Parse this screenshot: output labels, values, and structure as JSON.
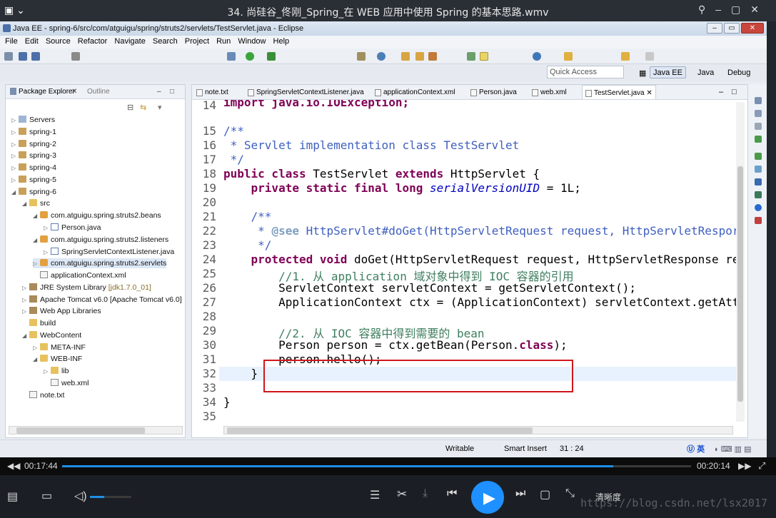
{
  "player": {
    "title": "34. 尚硅谷_佟刚_Spring_在 WEB 应用中使用 Spring 的基本思路.wmv",
    "time_elapsed": "00:17:44",
    "time_total": "00:20:14",
    "progress": 0.876,
    "volume": 0.35,
    "quality_label": "清晰度",
    "watermark": "https://blog.csdn.net/lsx2017"
  },
  "eclipse": {
    "window_title": "Java EE - spring-6/src/com/atguigu/spring/struts2/servlets/TestServlet.java - Eclipse",
    "menu": [
      "File",
      "Edit",
      "Source",
      "Refactor",
      "Navigate",
      "Search",
      "Project",
      "Run",
      "Window",
      "Help"
    ],
    "quick_access_placeholder": "Quick Access",
    "perspectives": [
      "Java EE",
      "Java",
      "Debug"
    ],
    "side_tabs": {
      "package_explorer": "Package Explorer",
      "outline": "Outline"
    },
    "tree": [
      {
        "label": "Servers",
        "icon": "server-folder-icon"
      },
      {
        "label": "spring-1",
        "icon": "project-icon"
      },
      {
        "label": "spring-2",
        "icon": "project-icon"
      },
      {
        "label": "spring-3",
        "icon": "project-icon"
      },
      {
        "label": "spring-4",
        "icon": "project-icon"
      },
      {
        "label": "spring-5",
        "icon": "project-icon"
      },
      {
        "label": "spring-6",
        "icon": "project-icon"
      },
      {
        "label": "src",
        "icon": "source-folder-icon"
      },
      {
        "label": "com.atguigu.spring.struts2.beans",
        "icon": "package-icon"
      },
      {
        "label": "Person.java",
        "icon": "java-file-icon"
      },
      {
        "label": "com.atguigu.spring.struts2.listeners",
        "icon": "package-icon"
      },
      {
        "label": "SpringServletContextListener.java",
        "icon": "java-file-icon"
      },
      {
        "label": "com.atguigu.spring.struts2.servlets",
        "icon": "package-icon"
      },
      {
        "label": "applicationContext.xml",
        "icon": "xml-file-icon"
      },
      {
        "label": "JRE System Library",
        "extra": "[jdk1.7.0_01]",
        "icon": "library-icon"
      },
      {
        "label": "Apache Tomcat v6.0 [Apache Tomcat v6.0]",
        "icon": "library-icon"
      },
      {
        "label": "Web App Libraries",
        "icon": "library-icon"
      },
      {
        "label": "build",
        "icon": "folder-icon"
      },
      {
        "label": "WebContent",
        "icon": "folder-icon"
      },
      {
        "label": "META-INF",
        "icon": "folder-icon"
      },
      {
        "label": "WEB-INF",
        "icon": "folder-icon"
      },
      {
        "label": "lib",
        "icon": "folder-icon"
      },
      {
        "label": "web.xml",
        "icon": "xml-file-icon"
      },
      {
        "label": "note.txt",
        "icon": "text-file-icon"
      }
    ],
    "editor_tabs": [
      "note.txt",
      "SpringServletContextListener.java",
      "applicationContext.xml",
      "Person.java",
      "web.xml",
      "TestServlet.java"
    ],
    "line_numbers": [
      "14",
      "15",
      "16",
      "17",
      "18",
      "19",
      "20",
      "21",
      "22",
      "23",
      "24",
      "25",
      "26",
      "27",
      "28",
      "29",
      "30",
      "31",
      "32",
      "33",
      "34",
      "35"
    ],
    "code_lines": {
      "l14": "import java.io.IOException;",
      "l15": "/**",
      "l16": " * Servlet implementation class TestServlet",
      "l17": " */",
      "l18_a": "public class ",
      "l18_b": "TestServlet ",
      "l18_c": "extends ",
      "l18_d": "HttpServlet {",
      "l19_a": "    private static final long ",
      "l19_b": "serialVersionUID",
      "l19_c": " = 1L;",
      "l21": "    /**",
      "l22_a": "     * ",
      "l22_b": "@see",
      "l22_c": " HttpServlet#doGet(HttpServletRequest request, HttpServletRespor",
      "l23": "     */",
      "l24_a": "    protected void ",
      "l24_b": "doGet(HttpServletRequest request, HttpServletResponse re",
      "l25": "        //1. 从 application 域对象中得到 IOC 容器的引用",
      "l26": "        ServletContext servletContext = getServletContext();",
      "l27": "        ApplicationContext ctx = (ApplicationContext) servletContext.getAtt",
      "l29": "        //2. 从 IOC 容器中得到需要的 bean",
      "l30_a": "        Person person = ctx.getBean(Person.",
      "l30_b": "class",
      "l30_c": ");",
      "l31": "        person.hello();",
      "l32": "    }",
      "l34": "}"
    },
    "status": {
      "writable": "Writable",
      "insert_mode": "Smart Insert",
      "position": "31 : 24"
    },
    "ime_label": "英"
  }
}
